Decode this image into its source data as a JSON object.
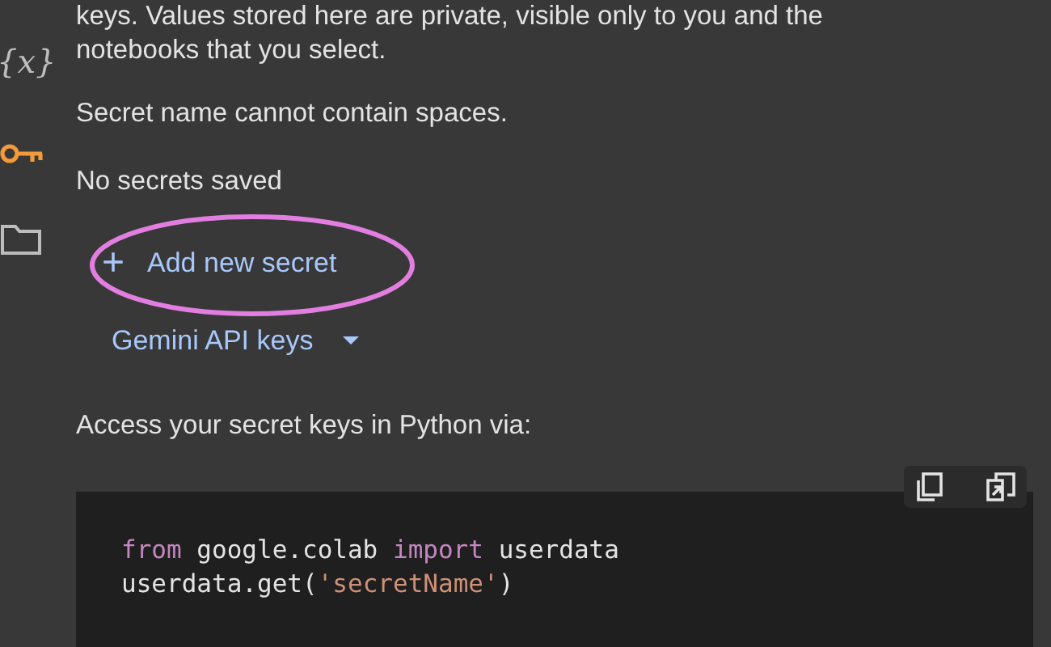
{
  "rail": [
    {
      "kind": "variables",
      "glyph": "{x}",
      "selected": false
    },
    {
      "kind": "key",
      "selected": true
    },
    {
      "kind": "folder",
      "selected": false
    }
  ],
  "intro": "keys. Values stored here are private, visible only to you and the notebooks that you select.",
  "rule": "Secret name cannot contain spaces.",
  "empty_state": "No secrets saved",
  "add_button": {
    "icon": "+",
    "label": "Add new secret",
    "annotation": {
      "kind": "ellipse",
      "color": "#e27ee0"
    }
  },
  "dropdown": {
    "label": "Gemini API keys"
  },
  "hint": "Access your secret keys in Python via:",
  "code": {
    "lines": [
      [
        {
          "kind": "keyword",
          "text": "from"
        },
        {
          "kind": "plain",
          "text": " google.colab "
        },
        {
          "kind": "keyword",
          "text": "import"
        },
        {
          "kind": "plain",
          "text": " userdata"
        }
      ],
      [
        {
          "kind": "plain",
          "text": "userdata.get("
        },
        {
          "kind": "string",
          "text": "'secretName'"
        },
        {
          "kind": "plain",
          "text": ")"
        }
      ]
    ]
  }
}
